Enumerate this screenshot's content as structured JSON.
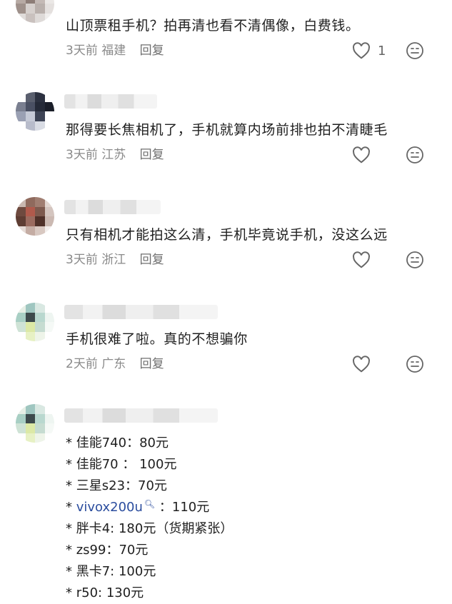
{
  "comments": [
    {
      "text": "山顶票租手机？拍再清也看不清偶像，白费钱。",
      "time": "3天前",
      "location": "福建",
      "reply_label": "回复",
      "like_count": "1"
    },
    {
      "text": "那得要长焦相机了，手机就算内场前排也拍不清睫毛",
      "time": "3天前",
      "location": "江苏",
      "reply_label": "回复"
    },
    {
      "text": "只有相机才能拍这么清，手机毕竟说手机，没这么远",
      "time": "3天前",
      "location": "浙江",
      "reply_label": "回复"
    },
    {
      "text": "手机很难了啦。真的不想骗你",
      "time": "2天前",
      "location": "广东",
      "reply_label": "回复"
    }
  ],
  "price_list": [
    {
      "prefix": "* ",
      "text": "佳能740：80元"
    },
    {
      "prefix": "* ",
      "text": "佳能70 ： 100元"
    },
    {
      "prefix": "* ",
      "text": "三星s23：70元"
    },
    {
      "prefix": "* ",
      "link": "vivox200u",
      "text": "   ：110元"
    },
    {
      "prefix": "* ",
      "text": "胖卡4: 180元（货期紧张）"
    },
    {
      "prefix": "* ",
      "text": "zs99：70元"
    },
    {
      "prefix": "* ",
      "text": "黑卡7: 100元"
    },
    {
      "prefix": "* ",
      "text": "r50: 130元"
    }
  ],
  "icons": {
    "like": "heart-outline-icon",
    "emoji": "emoji-face-icon",
    "search": "search-icon"
  },
  "colors": {
    "text": "#1f1f1f",
    "meta": "#8a8a8a",
    "link": "#2b4d9e"
  }
}
